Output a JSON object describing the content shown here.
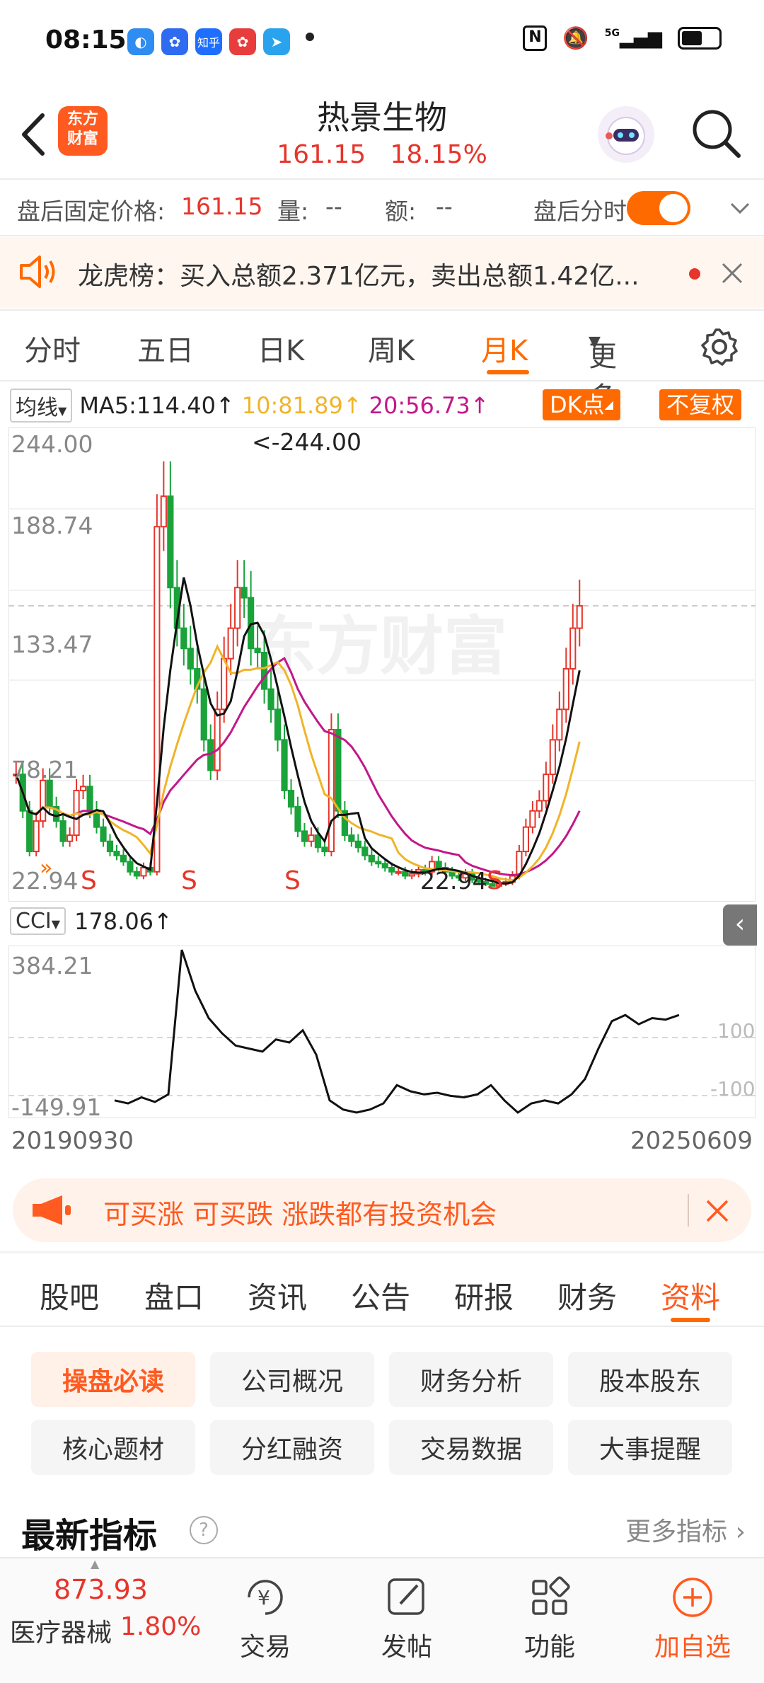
{
  "status_bar": {
    "time": "08:15",
    "apps": [
      {
        "icon": "edge-icon",
        "label": "",
        "color": "#2f8cf0"
      },
      {
        "icon": "baidu-icon",
        "label": "",
        "color": "#2f6bf0"
      },
      {
        "icon": "zhihu-icon",
        "label": "知乎",
        "color": "#1e6fff"
      },
      {
        "icon": "baidu-news-icon",
        "label": "",
        "color": "#e83d3d"
      },
      {
        "icon": "telegram-icon",
        "label": "",
        "color": "#2aa3ef"
      }
    ],
    "network": "5G"
  },
  "header": {
    "logo_text": "东方财富",
    "stock_name": "热景生物",
    "price": "161.15",
    "change_pct": "18.15%"
  },
  "after_hours": {
    "price_label": "盘后固定价格:",
    "price": "161.15",
    "volume_label": "量:",
    "volume": "--",
    "amount_label": "额:",
    "amount": "--",
    "intraday_label": "盘后分时"
  },
  "notice": {
    "text": "龙虎榜：买入总额2.371亿元，卖出总额1.42亿..."
  },
  "period_tabs": [
    {
      "label": "分时",
      "active": false
    },
    {
      "label": "五日",
      "active": false
    },
    {
      "label": "日K",
      "active": false
    },
    {
      "label": "周K",
      "active": false
    },
    {
      "label": "月K",
      "active": true
    },
    {
      "label": "更多",
      "active": false
    }
  ],
  "indicators": {
    "ma_select": "均线",
    "ma5": "MA5:114.40↑",
    "ma10": "10:81.89↑",
    "ma20": "20:56.73↑",
    "dk_button": "DK点",
    "adjust_button": "不复权",
    "cci_select": "CCI",
    "cci_value": "178.06↑"
  },
  "chart_data": {
    "type": "candlestick",
    "period": "monthly",
    "price_axis": [
      "244.00",
      "188.74",
      "133.47",
      "78.21",
      "22.94"
    ],
    "high_marker": "<-244.00",
    "low_marker": "22.94",
    "signal_marks": [
      "S",
      "S",
      "S",
      "S"
    ],
    "watermark": "东方财富",
    "cci_axis": [
      "384.21",
      "-149.91"
    ],
    "cci_ref_lines": [
      "100",
      "-100"
    ],
    "date_start": "20190930",
    "date_end": "20250609",
    "colors": {
      "up": "#e6352b",
      "down": "#1aa33a",
      "ma5": "#111111",
      "ma10": "#f0b429",
      "ma20": "#c2188a"
    }
  },
  "promo": {
    "text": "可买涨 可买跌 涨跌都有投资机会"
  },
  "section_tabs": [
    {
      "label": "股吧",
      "active": false
    },
    {
      "label": "盘口",
      "active": false
    },
    {
      "label": "资讯",
      "active": false
    },
    {
      "label": "公告",
      "active": false
    },
    {
      "label": "研报",
      "active": false
    },
    {
      "label": "财务",
      "active": false
    },
    {
      "label": "资料",
      "active": true
    }
  ],
  "info_buttons": [
    {
      "label": "操盘必读",
      "active": true
    },
    {
      "label": "公司概况",
      "active": false
    },
    {
      "label": "财务分析",
      "active": false
    },
    {
      "label": "股本股东",
      "active": false
    },
    {
      "label": "核心题材",
      "active": false
    },
    {
      "label": "分红融资",
      "active": false
    },
    {
      "label": "交易数据",
      "active": false
    },
    {
      "label": "大事提醒",
      "active": false
    }
  ],
  "latest": {
    "title": "最新指标",
    "more": "更多指标"
  },
  "bottom_bar": {
    "sector_value": "873.93",
    "sector_name": "医疗器械",
    "sector_change": "1.80%",
    "trade": "交易",
    "post": "发帖",
    "functions": "功能",
    "add_watch": "加自选"
  }
}
